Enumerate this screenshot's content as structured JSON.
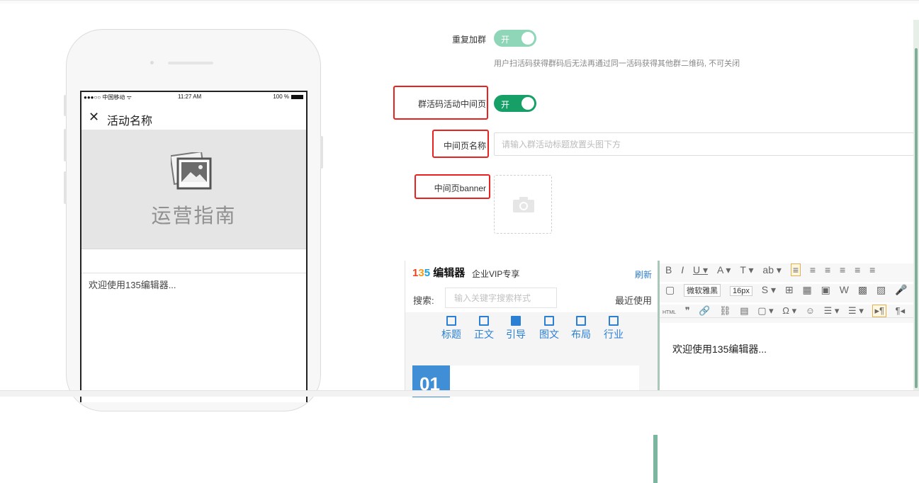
{
  "phone": {
    "status": {
      "carrier": "●●●○○ 中国移动 ᯤ",
      "time": "11:27 AM",
      "battery": "100 %"
    },
    "nav_title": "活动名称",
    "banner_logo_text": "运营指南",
    "welcome": "欢迎使用135编辑器..."
  },
  "form": {
    "repeat_join": {
      "label": "重复加群",
      "toggle_label": "开",
      "helper": "用户扫活码获得群码后无法再通过同一活码获得其他群二维码, 不可关闭",
      "color": "#8fd6b8"
    },
    "middle_page": {
      "label": "群活码活动中间页",
      "toggle_label": "开",
      "color": "#16a068"
    },
    "middle_name": {
      "label": "中间页名称",
      "placeholder": "请输入群活动标题放置头图下方",
      "value": ""
    },
    "middle_banner": {
      "label": "中间页banner"
    }
  },
  "editor": {
    "logo": {
      "n1": "1",
      "n3": "3",
      "n5": "5",
      "name": "编辑器"
    },
    "vip_label": "企业VIP专享",
    "refresh": "刷新",
    "search_label": "搜索:",
    "search_placeholder": "输入关键字搜索样式",
    "recent": "最近使用",
    "tabs": [
      "标题",
      "正文",
      "引导",
      "图文",
      "布局",
      "行业"
    ],
    "first_item_number": "01",
    "toolbar_row1": [
      "B",
      "I",
      "U ▾",
      "A ▾",
      "T ▾",
      "ab ▾",
      "≡",
      "≡",
      "≡",
      "≡",
      "≡",
      "≡"
    ],
    "toolbar_row2": {
      "font": "微软雅黑",
      "size": "16px",
      "strike": "S ▾",
      "items": [
        "⊞",
        "▦",
        "▣",
        "W",
        "▩",
        "▨",
        "🎤"
      ]
    },
    "toolbar_row3": [
      "HTML",
      "❞",
      "🔗",
      "⛓",
      "▤",
      "▢ ▾",
      "Ω ▾",
      "☺",
      "☰ ▾",
      "☰ ▾",
      "▸¶",
      "¶◂"
    ],
    "content": "欢迎使用135编辑器..."
  }
}
